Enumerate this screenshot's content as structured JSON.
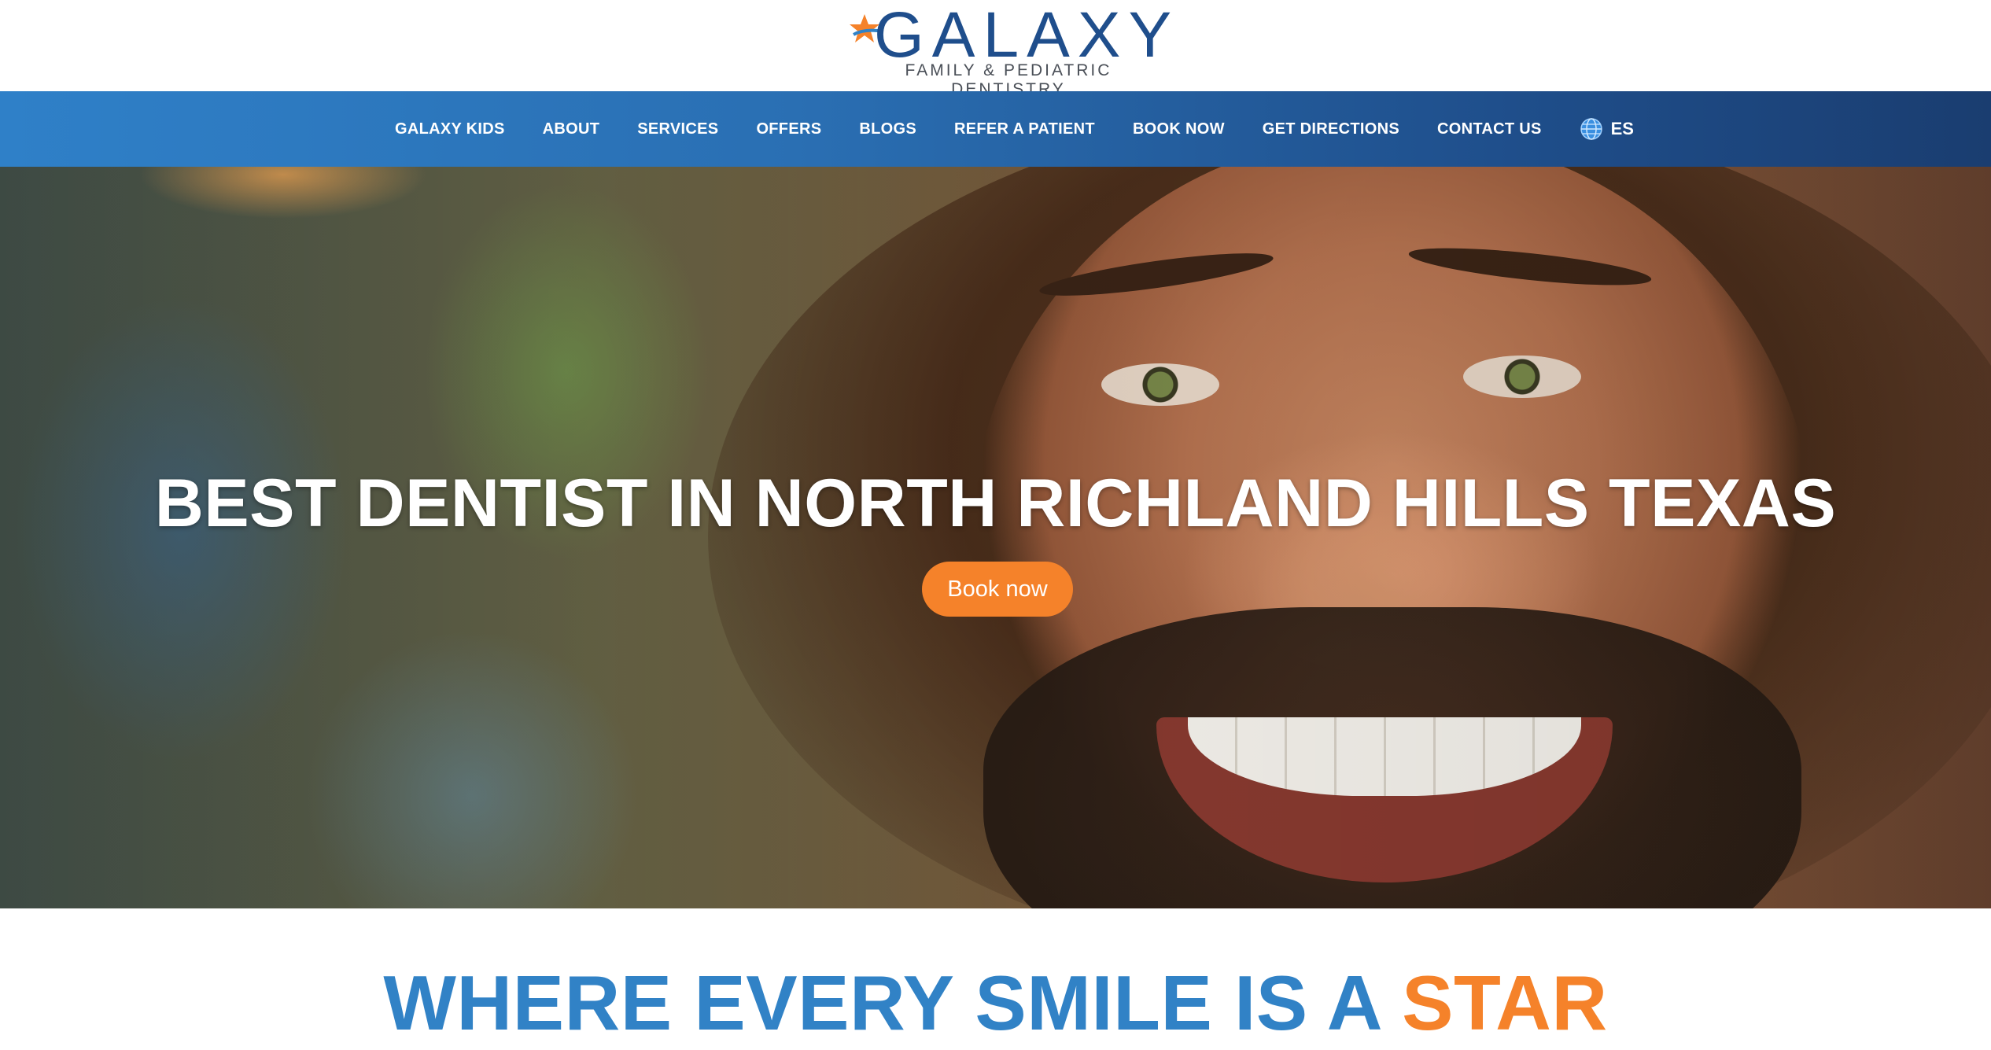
{
  "logo": {
    "wordmark": "GALAXY",
    "subtitle": "FAMILY & PEDIATRIC DENTISTRY"
  },
  "nav": {
    "items": [
      {
        "label": "GALAXY KIDS"
      },
      {
        "label": "ABOUT"
      },
      {
        "label": "SERVICES"
      },
      {
        "label": "OFFERS"
      },
      {
        "label": "BLOGS"
      },
      {
        "label": "REFER A PATIENT"
      },
      {
        "label": "BOOK NOW"
      },
      {
        "label": "GET DIRECTIONS"
      },
      {
        "label": "CONTACT US"
      }
    ],
    "language": {
      "label": "ES",
      "icon": "globe-icon"
    }
  },
  "hero": {
    "title": "BEST DENTIST IN NORTH RICHLAND HILLS TEXAS",
    "button_label": "Book now"
  },
  "tagline": {
    "part1": "WHERE EVERY SMILE IS A ",
    "part2": "STAR"
  },
  "colors": {
    "brand_blue": "#3182c6",
    "brand_navy": "#1f4e8c",
    "accent_orange": "#f5822a"
  }
}
